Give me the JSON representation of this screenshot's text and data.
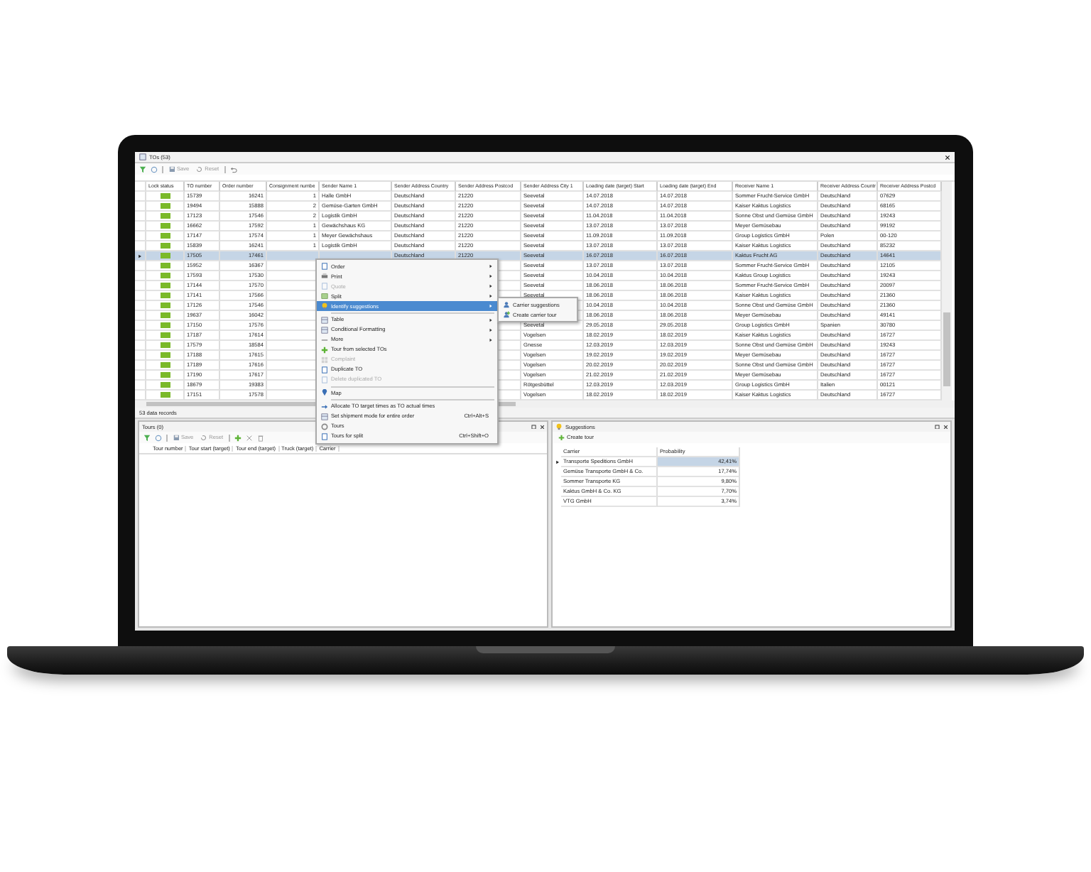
{
  "window": {
    "title": "TOs (53)"
  },
  "toolbar": [
    {
      "label": "Save",
      "disabled": true
    },
    {
      "label": "Reset",
      "disabled": true
    }
  ],
  "table": {
    "columns": [
      "Lock status",
      "TO number",
      "Order number",
      "Consignment numbe",
      "Sender Name 1",
      "Sender Address Country",
      "Sender Address Postcod",
      "Sender Address City 1",
      "Loading date (target) Start",
      "Loading date (target) End",
      "Receiver Name 1",
      "Receiver Address Countr",
      "Receiver Address Postcd"
    ],
    "rows": [
      {
        "selected": false,
        "to": "15739",
        "order": "16241",
        "consignment": "1",
        "sender_name": "Halle GmbH",
        "sender_country": "Deutschland",
        "sender_postcode": "21220",
        "sender_city": "Seevetal",
        "start": "14.07.2018",
        "end": "14.07.2018",
        "receiver_name": "Sommer Frucht-Service GmbH",
        "receiver_country": "Deutschland",
        "receiver_postcode": "07629"
      },
      {
        "selected": false,
        "to": "19494",
        "order": "15888",
        "consignment": "2",
        "sender_name": "Gemüse-Garten GmbH",
        "sender_country": "Deutschland",
        "sender_postcode": "21220",
        "sender_city": "Seevetal",
        "start": "14.07.2018",
        "end": "14.07.2018",
        "receiver_name": "Kaiser Kaktus Logistics",
        "receiver_country": "Deutschland",
        "receiver_postcode": "68165"
      },
      {
        "selected": false,
        "to": "17123",
        "order": "17546",
        "consignment": "2",
        "sender_name": "Logistik GmbH",
        "sender_country": "Deutschland",
        "sender_postcode": "21220",
        "sender_city": "Seevetal",
        "start": "11.04.2018",
        "end": "11.04.2018",
        "receiver_name": "Sonne Obst und Gemüse GmbH",
        "receiver_country": "Deutschland",
        "receiver_postcode": "19243"
      },
      {
        "selected": false,
        "to": "16662",
        "order": "17592",
        "consignment": "1",
        "sender_name": "Gewächshaus KG",
        "sender_country": "Deutschland",
        "sender_postcode": "21220",
        "sender_city": "Seevetal",
        "start": "13.07.2018",
        "end": "13.07.2018",
        "receiver_name": "Meyer Gemüsebau",
        "receiver_country": "Deutschland",
        "receiver_postcode": "99192"
      },
      {
        "selected": false,
        "to": "17147",
        "order": "17574",
        "consignment": "1",
        "sender_name": "Meyer Gewächshaus",
        "sender_country": "Deutschland",
        "sender_postcode": "21220",
        "sender_city": "Seevetal",
        "start": "11.09.2018",
        "end": "11.09.2018",
        "receiver_name": "Group Logistics GmbH",
        "receiver_country": "Polen",
        "receiver_postcode": "00-120"
      },
      {
        "selected": false,
        "to": "15839",
        "order": "16241",
        "consignment": "1",
        "sender_name": "Logistik GmbH",
        "sender_country": "Deutschland",
        "sender_postcode": "21220",
        "sender_city": "Seevetal",
        "start": "13.07.2018",
        "end": "13.07.2018",
        "receiver_name": "Kaiser Kaktus Logistics",
        "receiver_country": "Deutschland",
        "receiver_postcode": "85232"
      },
      {
        "selected": true,
        "to": "17505",
        "order": "17461",
        "sender_country": "Deutschland",
        "sender_postcode": "21220",
        "sender_city": "Seevetal",
        "start": "16.07.2018",
        "end": "16.07.2018",
        "receiver_name": "Kaktus Frucht AG",
        "receiver_country": "Deutschland",
        "receiver_postcode": "14641"
      },
      {
        "selected": false,
        "to": "15952",
        "order": "16367",
        "sender_city": "Seevetal",
        "start": "13.07.2018",
        "end": "13.07.2018",
        "receiver_name": "Sommer Frucht-Service GmbH",
        "receiver_country": "Deutschland",
        "receiver_postcode": "12105"
      },
      {
        "selected": false,
        "to": "17593",
        "order": "17530",
        "sender_city": "Seevetal",
        "start": "10.04.2018",
        "end": "10.04.2018",
        "receiver_name": "Kaktus Group Logistics",
        "receiver_country": "Deutschland",
        "receiver_postcode": "19243"
      },
      {
        "selected": false,
        "to": "17144",
        "order": "17570",
        "sender_city": "Seevetal",
        "start": "18.06.2018",
        "end": "18.06.2018",
        "receiver_name": "Sommer Frucht-Service GmbH",
        "receiver_country": "Deutschland",
        "receiver_postcode": "20097"
      },
      {
        "selected": false,
        "to": "17141",
        "order": "17566",
        "sender_city": "Seevetal",
        "start": "18.06.2018",
        "end": "18.06.2018",
        "receiver_name": "Kaiser Kaktus Logistics",
        "receiver_country": "Deutschland",
        "receiver_postcode": "21360"
      },
      {
        "selected": false,
        "to": "17126",
        "order": "17546",
        "start": "10.04.2018",
        "end": "10.04.2018",
        "receiver_name": "Sonne Obst und Gemüse GmbH",
        "receiver_country": "Deutschland",
        "receiver_postcode": "21360"
      },
      {
        "selected": false,
        "to": "19637",
        "order": "16042",
        "start": "18.06.2018",
        "end": "18.06.2018",
        "receiver_name": "Meyer Gemüsebau",
        "receiver_country": "Deutschland",
        "receiver_postcode": "49141"
      },
      {
        "selected": false,
        "to": "17150",
        "order": "17576",
        "sender_city": "Seevetal",
        "start": "29.05.2018",
        "end": "29.05.2018",
        "receiver_name": "Group Logistics GmbH",
        "receiver_country": "Spanien",
        "receiver_postcode": "30780"
      },
      {
        "selected": false,
        "to": "17187",
        "order": "17614",
        "sender_city": "Vogelsen",
        "start": "18.02.2019",
        "end": "18.02.2019",
        "receiver_name": "Kaiser Kaktus Logistics",
        "receiver_country": "Deutschland",
        "receiver_postcode": "16727"
      },
      {
        "selected": false,
        "to": "17579",
        "order": "18584",
        "sender_city": "Gnesse",
        "start": "12.03.2019",
        "end": "12.03.2019",
        "receiver_name": "Sonne Obst und Gemüse GmbH",
        "receiver_country": "Deutschland",
        "receiver_postcode": "19243"
      },
      {
        "selected": false,
        "to": "17188",
        "order": "17615",
        "sender_city": "Vogelsen",
        "start": "19.02.2019",
        "end": "19.02.2019",
        "receiver_name": "Meyer Gemüsebau",
        "receiver_country": "Deutschland",
        "receiver_postcode": "16727"
      },
      {
        "selected": false,
        "to": "17189",
        "order": "17616",
        "sender_city": "Vogelsen",
        "start": "20.02.2019",
        "end": "20.02.2019",
        "receiver_name": "Sonne Obst und Gemüse GmbH",
        "receiver_country": "Deutschland",
        "receiver_postcode": "16727"
      },
      {
        "selected": false,
        "to": "17190",
        "order": "17617",
        "sender_city": "Vogelsen",
        "start": "21.02.2019",
        "end": "21.02.2019",
        "receiver_name": "Meyer Gemüsebau",
        "receiver_country": "Deutschland",
        "receiver_postcode": "16727"
      },
      {
        "selected": false,
        "to": "18679",
        "order": "19383",
        "sender_city": "Rötgesbüttel",
        "start": "12.03.2019",
        "end": "12.03.2019",
        "receiver_name": "Group Logistics GmbH",
        "receiver_country": "Italien",
        "receiver_postcode": "00121"
      },
      {
        "selected": false,
        "to": "17151",
        "order": "17578",
        "sender_city": "Vogelsen",
        "start": "18.02.2019",
        "end": "18.02.2019",
        "receiver_name": "Kaiser Kaktus Logistics",
        "receiver_country": "Deutschland",
        "receiver_postcode": "16727"
      }
    ]
  },
  "status_bar": "53 data records",
  "tours": {
    "title": "Tours (0)",
    "toolbar": [
      {
        "label": "Save",
        "disabled": true
      },
      {
        "label": "Reset",
        "disabled": true
      }
    ],
    "columns": [
      "Tour number",
      "Tour start (target)",
      "Tour end (target)",
      "Truck (target)",
      "Carrier"
    ]
  },
  "suggestions": {
    "title": "Suggestions",
    "create": "Create tour",
    "columns": [
      "Carrier",
      "Probability"
    ],
    "rows": [
      {
        "carrier": "Transporte Speditions GmbH",
        "probability": "42,41%",
        "selected": true
      },
      {
        "carrier": "Gemüse Transporte GmbH & Co.",
        "probability": "17,74%",
        "selected": false
      },
      {
        "carrier": "Sommer Transporte KG",
        "probability": "9,80%",
        "selected": false
      },
      {
        "carrier": "Kaktus GmbH & Co. KG",
        "probability": "7,70%",
        "selected": false
      },
      {
        "carrier": "VTG GmbH",
        "probability": "3,74%",
        "selected": false
      }
    ]
  },
  "context_menu": {
    "items": [
      {
        "kind": "item",
        "label": "Order",
        "submenu": true,
        "disabled": false,
        "selected": false
      },
      {
        "kind": "item",
        "label": "Print",
        "submenu": true,
        "disabled": false,
        "selected": false
      },
      {
        "kind": "item",
        "label": "Quote",
        "submenu": true,
        "disabled": true,
        "selected": false
      },
      {
        "kind": "item",
        "label": "Split",
        "submenu": true,
        "disabled": false,
        "selected": false
      },
      {
        "kind": "item",
        "label": "Identify suggestions",
        "submenu": true,
        "disabled": false,
        "selected": true
      },
      {
        "kind": "separator"
      },
      {
        "kind": "item",
        "label": "Table",
        "submenu": true,
        "disabled": false,
        "selected": false
      },
      {
        "kind": "item",
        "label": "Conditional Formatting",
        "submenu": true,
        "disabled": false,
        "selected": false
      },
      {
        "kind": "item",
        "label": "More",
        "submenu": true,
        "disabled": false,
        "selected": false
      },
      {
        "kind": "item",
        "label": "Tour from selected TOs",
        "submenu": false,
        "disabled": false,
        "selected": false
      },
      {
        "kind": "item",
        "label": "Complaint",
        "submenu": false,
        "disabled": true,
        "selected": false
      },
      {
        "kind": "item",
        "label": "Duplicate TO",
        "submenu": false,
        "disabled": false,
        "selected": false
      },
      {
        "kind": "item",
        "label": "Delete duplicated TO",
        "submenu": false,
        "disabled": true,
        "selected": false
      },
      {
        "kind": "separator"
      },
      {
        "kind": "item",
        "label": "Map",
        "submenu": false,
        "disabled": false,
        "selected": false
      },
      {
        "kind": "separator"
      },
      {
        "kind": "item",
        "label": "Allocate TO target times as TO actual times",
        "submenu": false,
        "disabled": false,
        "selected": false
      },
      {
        "kind": "item",
        "label": "Set shipment mode for entire order",
        "shortcut": "Ctrl+Alt+S",
        "submenu": false,
        "disabled": false,
        "selected": false
      },
      {
        "kind": "item",
        "label": "Tours",
        "submenu": false,
        "disabled": false,
        "selected": false
      },
      {
        "kind": "item",
        "label": "Tours for split",
        "shortcut": "Ctrl+Shift+O",
        "submenu": false,
        "disabled": false,
        "selected": false
      }
    ]
  },
  "submenu": {
    "items": [
      {
        "label": "Carrier suggestions"
      },
      {
        "label": "Create carrier tour"
      }
    ]
  }
}
